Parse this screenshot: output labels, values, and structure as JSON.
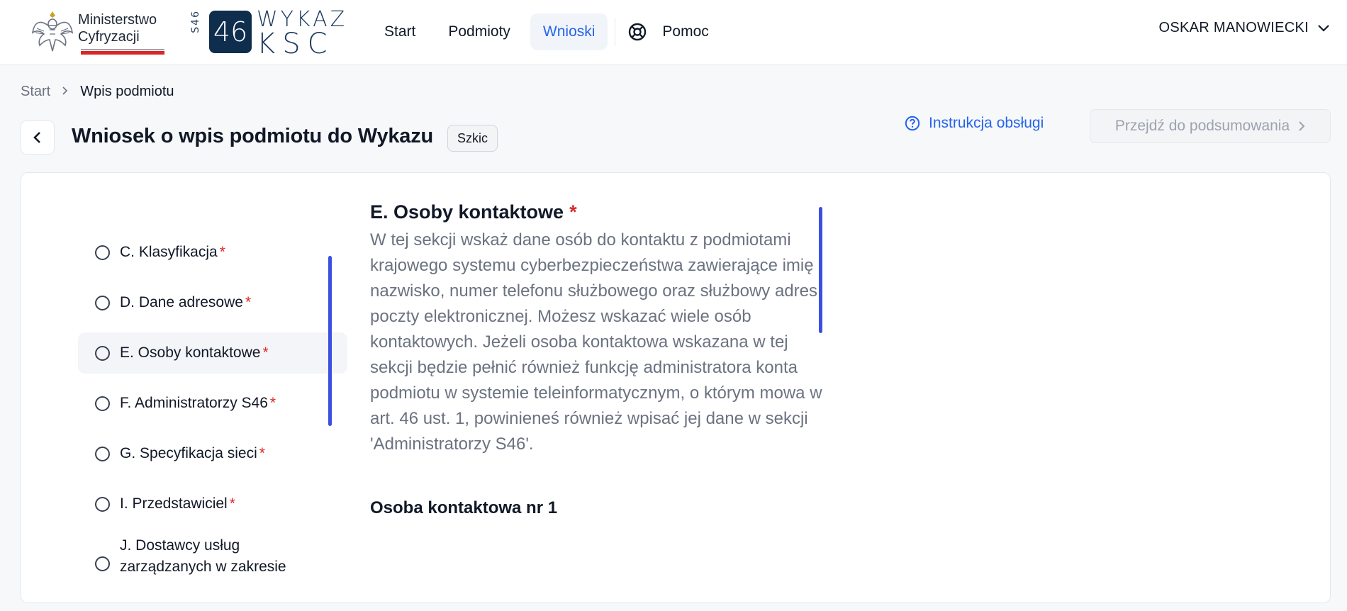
{
  "header": {
    "ministry_line1": "Ministerstwo",
    "ministry_line2": "Cyfryzacji",
    "s46_side": "S46",
    "s46_number": "46",
    "s46_word1": "WYKAZ",
    "s46_word2": "KSC",
    "nav": [
      {
        "label": "Start",
        "active": false
      },
      {
        "label": "Podmioty",
        "active": false
      },
      {
        "label": "Wnioski",
        "active": true
      }
    ],
    "help_label": "Pomoc",
    "user_name": "OSKAR MANOWIECKI"
  },
  "breadcrumb": {
    "start": "Start",
    "current": "Wpis podmiotu"
  },
  "page": {
    "title": "Wniosek o wpis podmiotu do Wykazu",
    "status_badge": "Szkic",
    "instruction_link": "Instrukcja obsługi",
    "summary_button": "Przejdź do podsumowania"
  },
  "steps": [
    {
      "label": "C. Klasyfikacja",
      "required": "*"
    },
    {
      "label": "D. Dane adresowe",
      "required": "*"
    },
    {
      "label": "E. Osoby kontaktowe",
      "required": "*",
      "active": true
    },
    {
      "label": "F. Administratorzy S46",
      "required": "*"
    },
    {
      "label": "G. Specyfikacja sieci",
      "required": "*"
    },
    {
      "label": "I. Przedstawiciel",
      "required": "*"
    },
    {
      "label_line1": "J. Dostawcy usług",
      "label_line2": "zarządzanych w zakresie"
    }
  ],
  "section": {
    "title": "E. Osoby kontaktowe",
    "required": "*",
    "description": "W tej sekcji wskaż dane osób do kontaktu z podmiotami krajowego systemu cyberbezpieczeństwa zawierające imię i nazwisko, numer telefonu służbowego oraz służbowy adres poczty elektronicznej. Możesz wskazać wiele osób kontaktowych. Jeżeli osoba kontaktowa wskazana w tej sekcji będzie pełnić również funkcję administratora konta podmiotu w systemie teleinformatycznym, o którym mowa w art. 46 ust. 1, powinieneś również wpisać jej dane w sekcji 'Administratorzy S46'.",
    "contact_title": "Osoba kontaktowa nr 1"
  },
  "colors": {
    "accent": "#2563eb",
    "required": "#dc2626",
    "scrollbar": "#3b4fe0",
    "brand_dark": "#0f2d4d"
  }
}
